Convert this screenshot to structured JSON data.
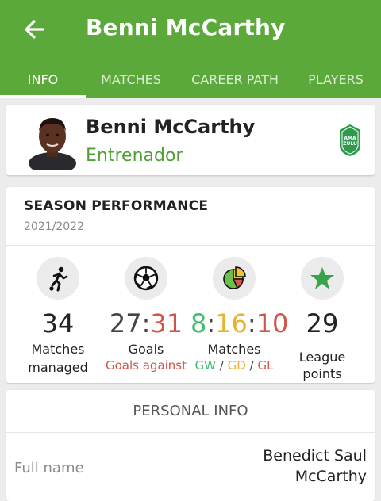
{
  "header": {
    "title": "Benni McCarthy",
    "tabs": [
      "INFO",
      "MATCHES",
      "CAREER PATH",
      "PLAYERS"
    ],
    "active_tab": 0,
    "colors": {
      "bar": "#5aa93a"
    }
  },
  "coach": {
    "name": "Benni McCarthy",
    "role": "Entrenador",
    "club_badge_text": "AMA ZULU"
  },
  "season": {
    "title": "SEASON PERFORMANCE",
    "year": "2021/2022",
    "stats": [
      {
        "icon": "player-running-icon",
        "value": "34",
        "label": "Matches",
        "sub": "managed"
      },
      {
        "icon": "soccer-ball-icon",
        "goals_for": "27",
        "sep": ":",
        "goals_against": "31",
        "label": "Goals",
        "sub": "Goals against"
      },
      {
        "icon": "pie-chart-icon",
        "won": "8",
        "drawn": "16",
        "lost": "10",
        "sep": ":",
        "label": "Matches",
        "gw": "GW",
        "gd": "GD",
        "gl": "GL",
        "slash": "/"
      },
      {
        "icon": "star-icon",
        "value": "29",
        "label": "League points"
      }
    ]
  },
  "personal": {
    "title": "PERSONAL INFO",
    "fields": [
      {
        "label": "Full name",
        "value": "Benedict Saul McCarthy"
      }
    ]
  }
}
